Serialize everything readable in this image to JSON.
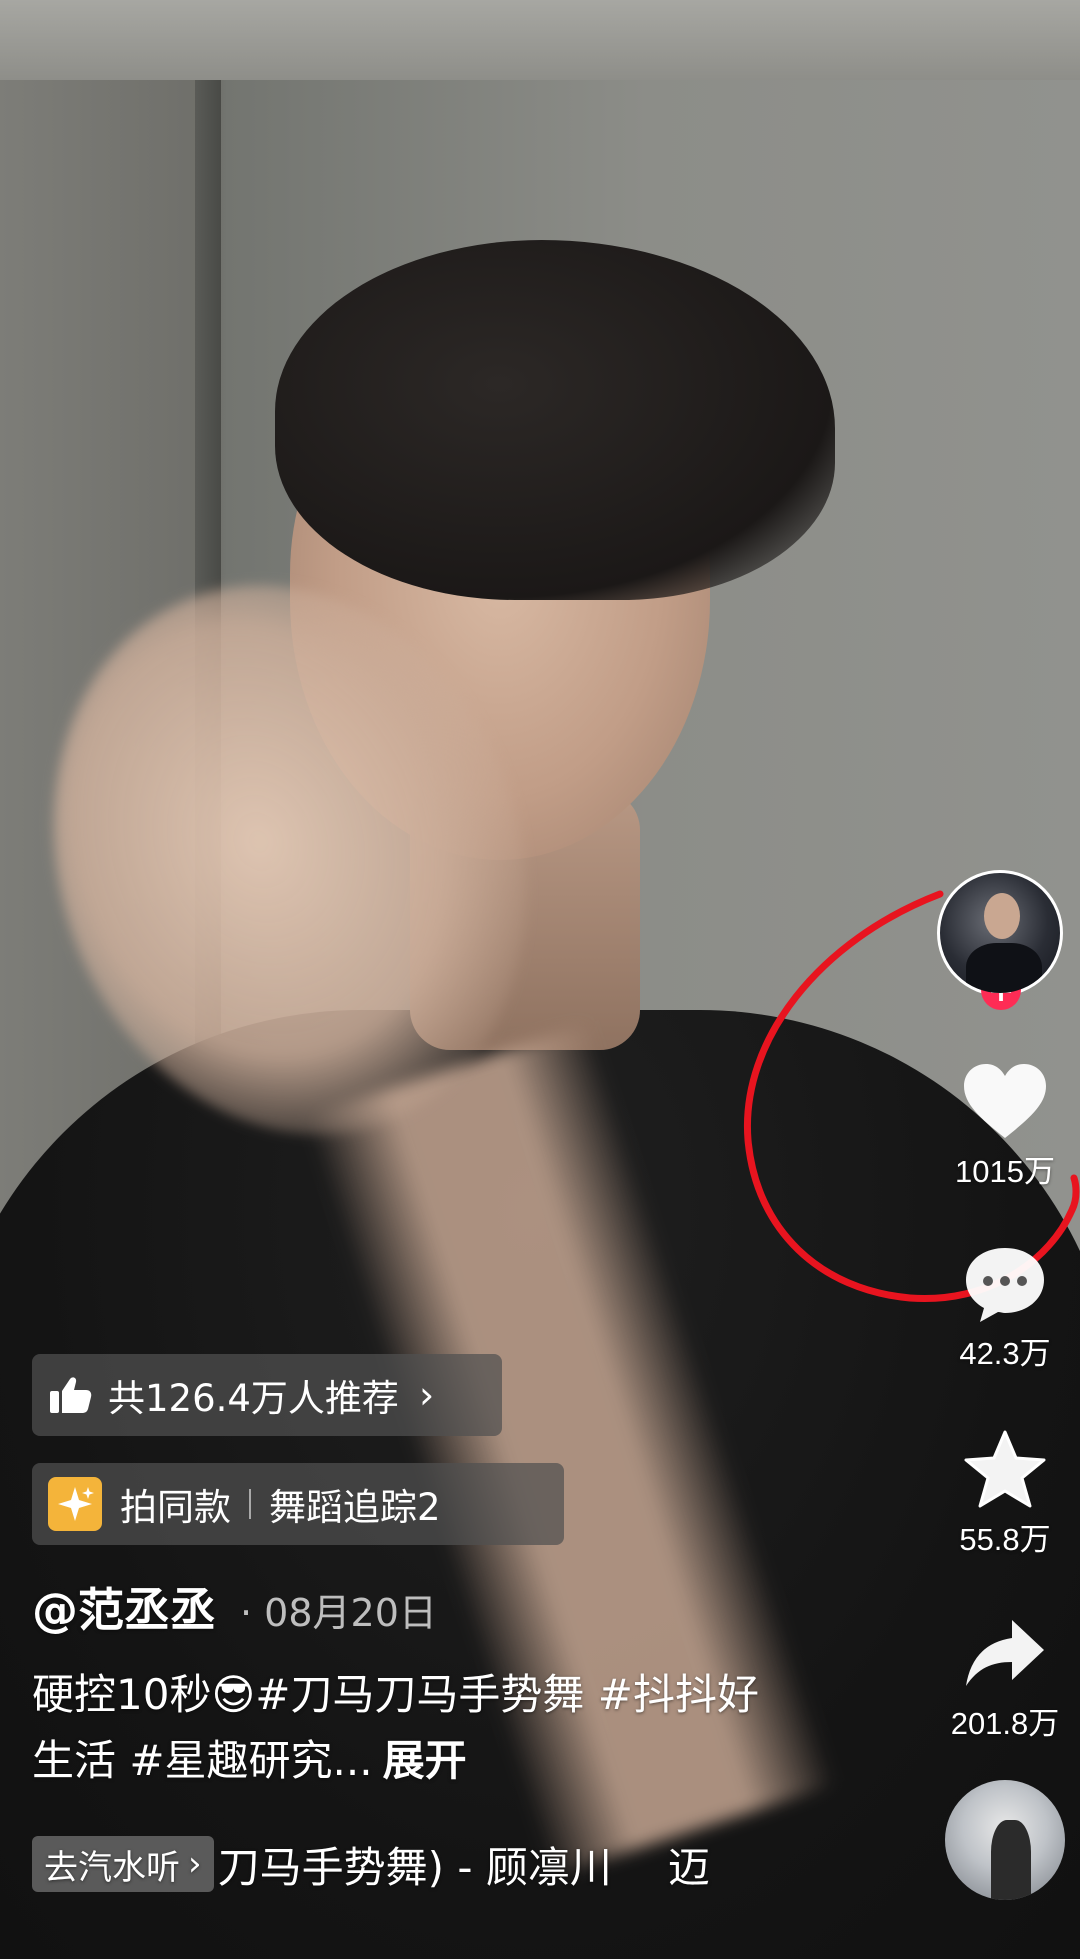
{
  "actions": {
    "likes": "1015万",
    "comments": "42.3万",
    "favorites": "55.8万",
    "shares": "201.8万"
  },
  "recommend": {
    "label": "共126.4万人推荐"
  },
  "same_style": {
    "label": "拍同款",
    "effect": "舞蹈追踪2"
  },
  "post": {
    "author": "@范丞丞",
    "date": "· 08月20日",
    "caption": "硬控10秒😎#刀马刀马手势舞 #抖抖好生活 #星趣研究...",
    "expand": "展开"
  },
  "music": {
    "chip_label": "去汽水听",
    "title": "刀马手势舞) - 顾凛川",
    "tail": "迈"
  },
  "colors": {
    "like_accent": "#fe2c55",
    "annotation": "#e8141f",
    "spark": "#f4b43a"
  }
}
